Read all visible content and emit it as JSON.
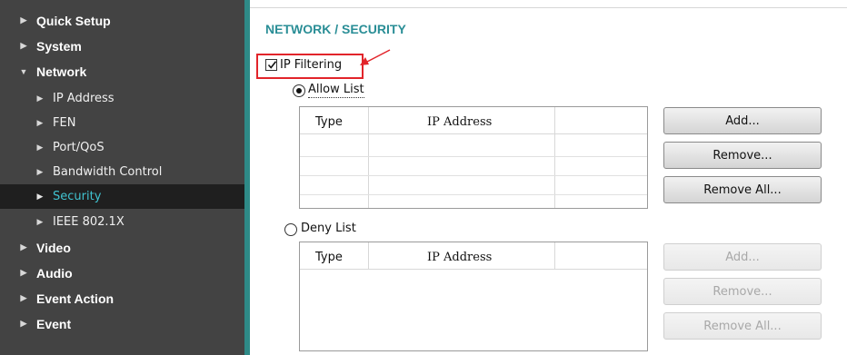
{
  "sidebar": {
    "items": [
      {
        "label": "Quick Setup",
        "level": "top",
        "expanded": false
      },
      {
        "label": "System",
        "level": "top",
        "expanded": false
      },
      {
        "label": "Network",
        "level": "top",
        "expanded": true
      },
      {
        "label": "IP Address",
        "level": "sub"
      },
      {
        "label": "FEN",
        "level": "sub"
      },
      {
        "label": "Port/QoS",
        "level": "sub"
      },
      {
        "label": "Bandwidth Control",
        "level": "sub"
      },
      {
        "label": "Security",
        "level": "sub",
        "active": true
      },
      {
        "label": "IEEE 802.1X",
        "level": "sub"
      },
      {
        "label": "Video",
        "level": "top",
        "expanded": false
      },
      {
        "label": "Audio",
        "level": "top",
        "expanded": false
      },
      {
        "label": "Event Action",
        "level": "top",
        "expanded": false
      },
      {
        "label": "Event",
        "level": "top",
        "expanded": false
      }
    ],
    "colors": {
      "background": "#434343",
      "active_bg": "#1f1f1f",
      "active_text": "#40c3d0",
      "accent_strip": "#2e8a87"
    }
  },
  "main": {
    "title": "NETWORK / SECURITY",
    "title_color": "#2a8e96",
    "ip_filtering": {
      "label": "IP Filtering",
      "checked": true,
      "highlight_color": "#e2242a"
    },
    "allow": {
      "label": "Allow List",
      "selected": true,
      "columns": [
        "Type",
        "IP Address",
        ""
      ],
      "rows": [],
      "buttons": {
        "add": "Add...",
        "remove": "Remove...",
        "remove_all": "Remove All..."
      },
      "buttons_enabled": true
    },
    "deny": {
      "label": "Deny List",
      "selected": false,
      "columns": [
        "Type",
        "IP Address",
        ""
      ],
      "rows": [],
      "buttons": {
        "add": "Add...",
        "remove": "Remove...",
        "remove_all": "Remove All..."
      },
      "buttons_enabled": false
    }
  }
}
